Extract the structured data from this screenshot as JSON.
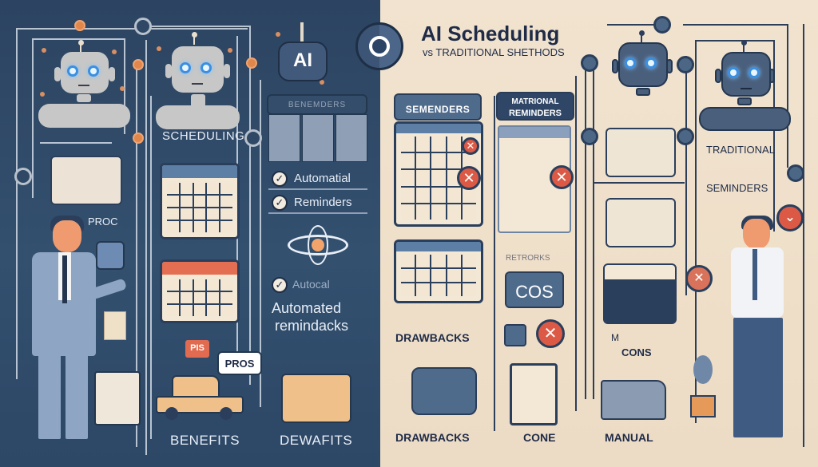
{
  "title": "AI Scheduling",
  "subtitle": "vs TRADITIONAL SHETHODS",
  "left_side": {
    "theme": "AI scheduling",
    "bg_color": "#2e4868",
    "accent_color": "#e0874c",
    "robot_badge": "AI",
    "labels": {
      "scheduling": "SCHEDULING",
      "proc": "PROC",
      "benemders": "BENEMDERS",
      "automatial": "Automatial",
      "reminders": "Reminders",
      "autocal": "Autocal",
      "automated": "Automated",
      "remindacks": "remindacks",
      "pis": "PIS",
      "pros": "PROS",
      "benefits": "BENEFITS",
      "dewafits": "DEWAFITS"
    }
  },
  "right_side": {
    "theme": "Traditional methods",
    "bg_color": "#efdfc9",
    "accent_color": "#dc5a45",
    "labels": {
      "semenders": "SEMENDERS",
      "matrional": "MATRIONAL",
      "reminders_caps": "REMINDERS",
      "cos": "COS",
      "drawbacks_1": "DRAWBACKS",
      "drawbacks_2": "DRAWBACKS",
      "cone": "CONE",
      "cons": "CONS",
      "m": "M",
      "manual": "MANUAL",
      "traditional": "TRADITIONAL",
      "seminders": "SEMINDERS",
      "remarks": "RETRORKS"
    }
  },
  "icons": {
    "x": "✕",
    "check": "✓",
    "chevron": "⌄"
  }
}
